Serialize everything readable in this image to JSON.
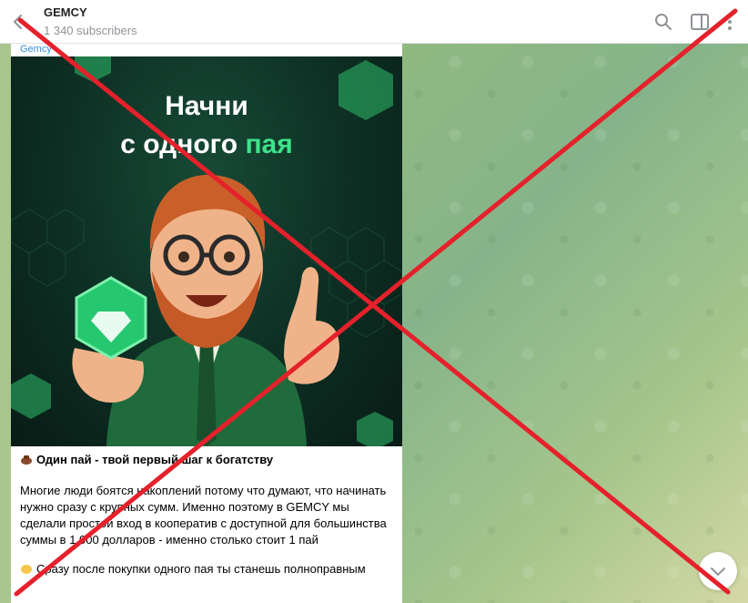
{
  "header": {
    "title": "GEMCY",
    "subscribers": "1 340 subscribers"
  },
  "post": {
    "author_fragment": "Gemcy",
    "image_headline_line1": "Начни",
    "image_headline_line2_prefix": "с одного ",
    "image_headline_line2_accent": "пая",
    "heading": "Один пай - твой первый шаг к богатству",
    "paragraph1": "Многие люди боятся накоплений потому что думают, что начинать нужно сразу с крупных сумм. Именно поэтому в GEMCY мы сделали простой вход в кооператив с доступной для большинства суммы в 1 000 долларов - именно столько стоит 1 пай",
    "paragraph2": "Сразу после покупки одного пая ты станешь полноправным"
  },
  "colors": {
    "accent_green": "#3fe28a",
    "overlay_red": "#e5212b",
    "link_blue": "#3a8fd6"
  },
  "icons": [
    "back-arrow-icon",
    "search-icon",
    "sidebar-toggle-icon",
    "more-vertical-icon",
    "gem-icon",
    "bag-emoji-icon",
    "hand-emoji-icon",
    "chevron-down-icon"
  ]
}
